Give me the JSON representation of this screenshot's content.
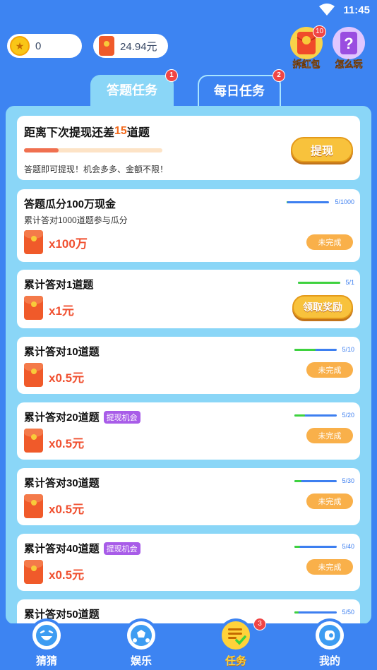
{
  "status_bar": {
    "time": "11:45"
  },
  "header": {
    "coins": {
      "value": "0"
    },
    "cash": {
      "value": "24.94元"
    },
    "red_packet_btn": {
      "label": "拆红包",
      "badge": "10"
    },
    "how_to_play_btn": {
      "label": "怎么玩"
    }
  },
  "tabs": [
    {
      "label": "答题任务",
      "badge": "1",
      "active": true
    },
    {
      "label": "每日任务",
      "badge": "2",
      "active": false
    }
  ],
  "withdraw_card": {
    "title_prefix": "距离下次提现还差",
    "remaining": "15",
    "title_suffix": "道题",
    "progress": 0.25,
    "note": "答题即可提现！机会多多、金额不限！",
    "button": "提现"
  },
  "tasks": [
    {
      "title": "答题瓜分100万现金",
      "sub": "累计答对1000道题参与瓜分",
      "reward": "x100万",
      "progress_text": "5/1000",
      "progress": 0.005,
      "button": "未完成",
      "tag": ""
    },
    {
      "title": "累计答对1道题",
      "reward": "x1元",
      "progress_text": "5/1",
      "progress": 1.0,
      "button": "领取奖励",
      "tag": ""
    },
    {
      "title": "累计答对10道题",
      "reward": "x0.5元",
      "progress_text": "5/10",
      "progress": 0.5,
      "button": "未完成",
      "tag": ""
    },
    {
      "title": "累计答对20道题",
      "reward": "x0.5元",
      "progress_text": "5/20",
      "progress": 0.25,
      "button": "未完成",
      "tag": "提现机会"
    },
    {
      "title": "累计答对30道题",
      "reward": "x0.5元",
      "progress_text": "5/30",
      "progress": 0.167,
      "button": "未完成",
      "tag": ""
    },
    {
      "title": "累计答对40道题",
      "reward": "x0.5元",
      "progress_text": "5/40",
      "progress": 0.125,
      "button": "未完成",
      "tag": "提现机会"
    },
    {
      "title": "累计答对50道题",
      "progress_text": "5/50",
      "progress": 0.1,
      "tag": ""
    }
  ],
  "bottom_nav": [
    {
      "label": "猜猜",
      "icon": "laugh-face-icon"
    },
    {
      "label": "娱乐",
      "icon": "soccer-ball-icon"
    },
    {
      "label": "任务",
      "icon": "task-list-icon",
      "badge": "3",
      "active": true
    },
    {
      "label": "我的",
      "icon": "profile-icon"
    }
  ],
  "colors": {
    "background": "#3d84f2",
    "panel": "#8ad6f7",
    "accent_orange": "#f36a1c",
    "reward_red": "#f05030",
    "progress_green": "#3ed23e"
  }
}
